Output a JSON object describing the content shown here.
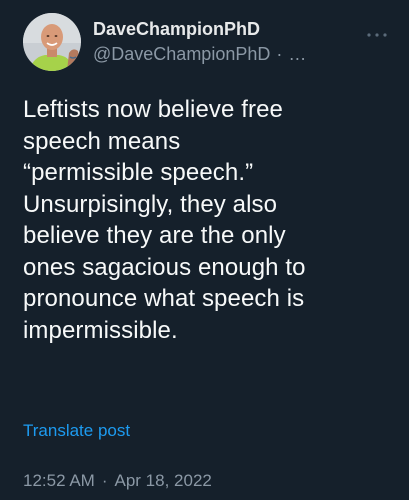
{
  "author": {
    "display_name": "DaveChampionPhD",
    "handle": "@DaveChampionPhD",
    "separator": "·",
    "truncation": "…",
    "avatar_icon": "avatar-photo"
  },
  "more_icon": "more-horizontal-icon",
  "body": {
    "lines": [
      "Leftists now believe free",
      "speech means",
      "“permissible speech.”",
      "Unsurpisingly, they also",
      "believe they are the only",
      "ones sagacious enough to",
      "pronounce what speech is",
      "impermissible."
    ]
  },
  "translate_label": "Translate post",
  "timestamp": {
    "time": "12:52 AM",
    "separator": "·",
    "date": "Apr 18, 2022"
  },
  "colors": {
    "background": "#15202b",
    "text": "#f7f9f9",
    "muted": "#8b98a5",
    "link": "#1d9bf0"
  }
}
